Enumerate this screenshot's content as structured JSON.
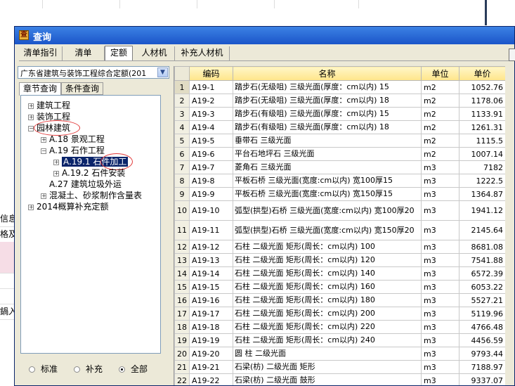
{
  "background": {
    "left_texts": [
      "信息",
      "格及",
      "",
      "",
      "",
      "",
      "",
      "",
      "鍋入式",
      ""
    ]
  },
  "dialog": {
    "title": "查询",
    "tabs": [
      "清单指引",
      "清单",
      "定额",
      "人材机",
      "补充人材机"
    ],
    "active_tab": "定额",
    "quota_selector": {
      "value": "广东省建筑与装饰工程综合定额(201"
    },
    "subtabs": [
      "章节查询",
      "条件查询"
    ],
    "active_subtab": "章节查询",
    "tree": [
      {
        "label": "建筑工程",
        "expander": "+"
      },
      {
        "label": "装饰工程",
        "expander": "+"
      },
      {
        "label": "园林建筑",
        "expander": "-"
      },
      {
        "label": "A.18 景观工程",
        "expander": "+"
      },
      {
        "label": "A.19 石作工程",
        "expander": "-"
      },
      {
        "label": "A.19.1 石件加工",
        "expander": "+"
      },
      {
        "label": "A.19.2 石件安装",
        "expander": "+"
      },
      {
        "label": "A.27 建筑垃圾外运",
        "expander": ""
      },
      {
        "label": "混凝土、砂浆制作含量表",
        "expander": "+"
      },
      {
        "label": "2014概算补充定额",
        "expander": "+"
      }
    ],
    "filter": {
      "options": [
        "标准",
        "补充",
        "全部"
      ],
      "selected": "全部"
    },
    "grid": {
      "columns": [
        "",
        "编码",
        "名称",
        "单位",
        "单价"
      ],
      "rows": [
        {
          "no": "1",
          "code": "A19-1",
          "name": "踏步石(无级咀) 三级光面(厚度：cm以内) 15",
          "unit": "m2",
          "price": "1052.76"
        },
        {
          "no": "2",
          "code": "A19-2",
          "name": "踏步石(无级咀) 三级光面(厚度：cm以内) 18",
          "unit": "m2",
          "price": "1178.06"
        },
        {
          "no": "3",
          "code": "A19-3",
          "name": "踏步石(有级咀) 三级光面(厚度：cm以内) 15",
          "unit": "m2",
          "price": "1133.91"
        },
        {
          "no": "4",
          "code": "A19-4",
          "name": "踏步石(有级咀) 三级光面(厚度：cm以内) 18",
          "unit": "m2",
          "price": "1261.31"
        },
        {
          "no": "5",
          "code": "A19-5",
          "name": "垂带石 三级光面",
          "unit": "m2",
          "price": "1115.5"
        },
        {
          "no": "6",
          "code": "A19-6",
          "name": "平台石地坪石 三级光面",
          "unit": "m2",
          "price": "1007.14"
        },
        {
          "no": "7",
          "code": "A19-7",
          "name": "菱角石 三级光面",
          "unit": "m3",
          "price": "7182"
        },
        {
          "no": "8",
          "code": "A19-8",
          "name": "平板石桥 三级光面(宽度:cm以内) 宽100厚15",
          "unit": "m3",
          "price": "1222.5"
        },
        {
          "no": "9",
          "code": "A19-9",
          "name": "平板石桥 三级光面(宽度:cm以内) 宽150厚15",
          "unit": "m3",
          "price": "1364.87"
        },
        {
          "no": "10",
          "code": "A19-10",
          "name": "弧型(拱型)石桥 三级光面(宽度:cm以内) 宽100厚20",
          "unit": "m3",
          "price": "1941.12",
          "tall": true
        },
        {
          "no": "11",
          "code": "A19-11",
          "name": "弧型(拱型)石桥 三级光面(宽度:cm以内) 宽150厚20",
          "unit": "m3",
          "price": "2145.64",
          "tall": true
        },
        {
          "no": "12",
          "code": "A19-12",
          "name": "石柱 二级光面 矩形(周长：cm以内) 100",
          "unit": "m3",
          "price": "8681.08"
        },
        {
          "no": "13",
          "code": "A19-13",
          "name": "石柱 二级光面 矩形(周长：cm以内) 120",
          "unit": "m3",
          "price": "7541.88"
        },
        {
          "no": "14",
          "code": "A19-14",
          "name": "石柱 二级光面 矩形(周长：cm以内) 140",
          "unit": "m3",
          "price": "6572.39"
        },
        {
          "no": "15",
          "code": "A19-15",
          "name": "石柱 二级光面 矩形(周长：cm以内) 160",
          "unit": "m3",
          "price": "6053.22"
        },
        {
          "no": "16",
          "code": "A19-16",
          "name": "石柱 二级光面 矩形(周长：cm以内) 180",
          "unit": "m3",
          "price": "5527.21"
        },
        {
          "no": "17",
          "code": "A19-17",
          "name": "石柱 二级光面 矩形(周长：cm以内) 200",
          "unit": "m3",
          "price": "5119.96"
        },
        {
          "no": "18",
          "code": "A19-18",
          "name": "石柱 二级光面 矩形(周长：cm以内) 220",
          "unit": "m3",
          "price": "4766.48"
        },
        {
          "no": "19",
          "code": "A19-19",
          "name": "石柱 二级光面 矩形(周长：cm以内) 240",
          "unit": "m3",
          "price": "4456.59"
        },
        {
          "no": "20",
          "code": "A19-20",
          "name": "圆 柱 二级光面",
          "unit": "m3",
          "price": "9793.44"
        },
        {
          "no": "21",
          "code": "A19-21",
          "name": "石梁(枋) 二级光面 矩形",
          "unit": "m3",
          "price": "7188.97"
        },
        {
          "no": "22",
          "code": "A19-22",
          "name": "石梁(枋) 二级光面 鼓形",
          "unit": "m3",
          "price": "9337.07"
        }
      ]
    }
  },
  "icons": {
    "title_icon": "query-app-icon",
    "dropdown_icon": "chevron-down-icon",
    "tree_expander": "plus-minus-expander-icon"
  },
  "colors": {
    "titlebar": "#1b55c9",
    "header_fill": "#ffe58a",
    "selection": "#0a246a",
    "highlight_circle": "#e23a3a",
    "dialog_bg": "#ece9d8"
  }
}
